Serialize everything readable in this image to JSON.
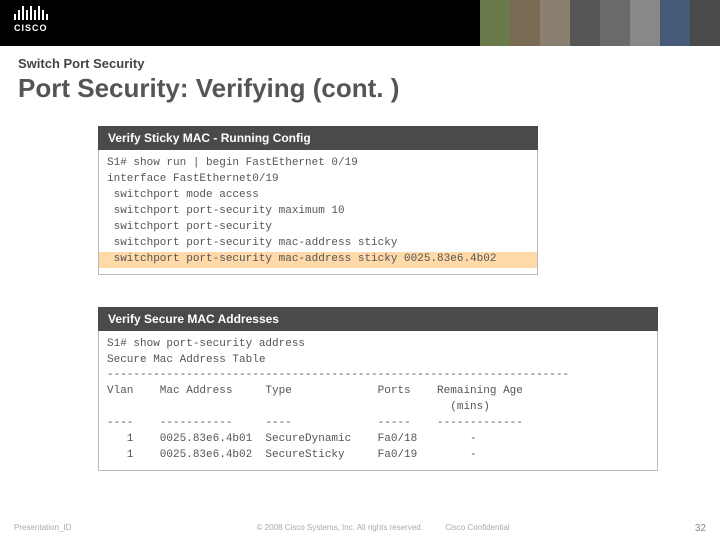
{
  "banner": {
    "logo_text": "CISCO"
  },
  "breadcrumb": "Switch Port Security",
  "title": "Port Security: Verifying (cont. )",
  "section1": {
    "header": "Verify Sticky MAC - Running Config",
    "line1": "S1# show run | begin FastEthernet 0/19",
    "line2": "interface FastEthernet0/19",
    "line3": " switchport mode access",
    "line4": " switchport port-security maximum 10",
    "line5": " switchport port-security",
    "line6": " switchport port-security mac-address sticky",
    "line7": " switchport port-security mac-address sticky 0025.83e6.4b02"
  },
  "section2": {
    "header": "Verify Secure MAC Addresses",
    "line1": "S1# show port-security address",
    "line2": "Secure Mac Address Table",
    "line3": "----------------------------------------------------------------------",
    "line4": "Vlan    Mac Address     Type             Ports    Remaining Age",
    "line5": "                                                    (mins)",
    "line6": "----    -----------     ----             -----    -------------",
    "line7": "   1    0025.83e6.4b01  SecureDynamic    Fa0/18        -",
    "line8": "   1    0025.83e6.4b02  SecureSticky     Fa0/19        -"
  },
  "footer": {
    "left": "Presentation_ID",
    "center": "© 2008 Cisco Systems, Inc. All rights reserved.",
    "right": "Cisco Confidential",
    "page": "32"
  }
}
